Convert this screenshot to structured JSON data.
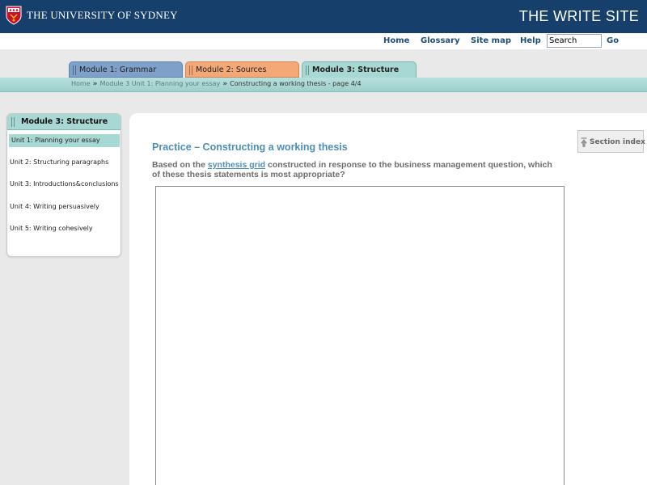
{
  "header": {
    "university": "THE UNIVERSITY OF SYDNEY",
    "site_title": "THE WRITE SITE"
  },
  "topnav": {
    "home": "Home",
    "glossary": "Glossary",
    "site_map": "Site map",
    "help": "Help",
    "search_value": "Search",
    "go": "Go"
  },
  "tabs": [
    {
      "label": "Module 1: Grammar"
    },
    {
      "label": "Module 2: Sources"
    },
    {
      "label": "Module 3: Structure",
      "active": true
    }
  ],
  "breadcrumb": {
    "home": "Home",
    "sep": "»",
    "unit": "Module 3 Unit 1: Planning your essay",
    "current": "Constructing a working thesis - page 4/4"
  },
  "sidebar": {
    "title": "Module 3: Structure",
    "items": [
      {
        "label": "Unit 1: Planning your essay",
        "active": true
      },
      {
        "label": "Unit 2: Structuring paragraphs"
      },
      {
        "label": "Unit 3: Introductions&conclusions"
      },
      {
        "label": "Unit 4: Writing persuasively"
      },
      {
        "label": "Unit 5: Writing cohesively"
      }
    ]
  },
  "main": {
    "title": "Practice – Constructing a working thesis",
    "question_before": "Based on the ",
    "question_link": "synthesis grid",
    "question_after": " constructed in response to the business management question, which of these thesis statements is most appropriate?",
    "section_index": "Section index"
  },
  "colors": {
    "header_bg": "#16406b",
    "tab_grammar": "#7fa0c8",
    "tab_sources": "#f3a878",
    "tab_structure": "#a8d8d4",
    "title_blue": "#4d8fb8"
  }
}
